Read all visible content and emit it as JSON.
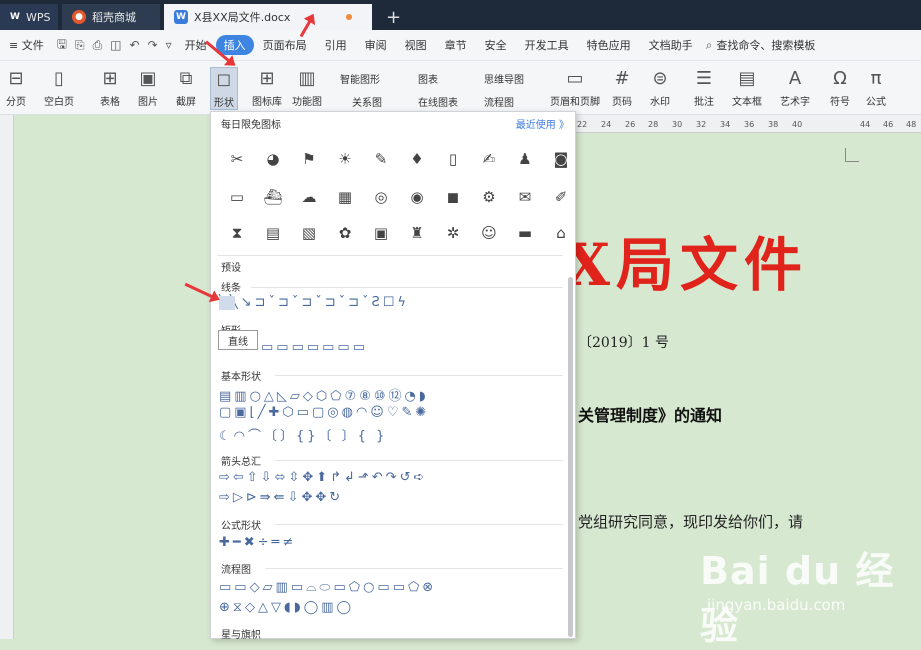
{
  "tabs": {
    "wps": "WPS",
    "shop": "稻壳商城",
    "doc": "X县XX局文件.docx",
    "add": "+"
  },
  "menu": {
    "file": "≡ 文件",
    "items": [
      "开始",
      "插入",
      "页面布局",
      "引用",
      "审阅",
      "视图",
      "章节",
      "安全",
      "开发工具",
      "特色应用",
      "文档助手"
    ],
    "active": "插入",
    "search": "查找命令、搜索模板"
  },
  "ribbon": {
    "page_break": "分页",
    "blank_page": "空白页",
    "table": "表格",
    "picture": "图片",
    "screenshot": "截屏",
    "shapes": "形状",
    "icon_lib": "图标库",
    "func_chart": "功能图",
    "smart_shape": "智能图形",
    "chart": "图表",
    "mindmap": "思维导图",
    "relation": "关系图",
    "online_chart": "在线图表",
    "flowchart": "流程图",
    "header_footer": "页眉和页脚",
    "page_no": "页码",
    "watermark": "水印",
    "comment": "批注",
    "textbox": "文本框",
    "art_text": "艺术字",
    "symbol": "符号",
    "formula": "公式"
  },
  "ruler": [
    "22",
    "24",
    "26",
    "28",
    "30",
    "32",
    "34",
    "36",
    "38",
    "40",
    "44",
    "46",
    "48"
  ],
  "document": {
    "title": "X局文件",
    "doc_no": "〔2019〕1 号",
    "subject": "关管理制度》的通知",
    "body": "党组研究同意，现印发给你们，请"
  },
  "panel": {
    "header": "每日限免图标",
    "recent": "最近使用 》",
    "presets": "预设",
    "lines": "线条",
    "rect": "矩形",
    "tooltip": "直线",
    "basic": "基本形状",
    "arrows": "箭头总汇",
    "formula_shapes": "公式形状",
    "flow": "流程图",
    "stars": "星与旗帜"
  },
  "watermark": {
    "brand": "Bai du 经验",
    "url": "jingyan.baidu.com"
  }
}
